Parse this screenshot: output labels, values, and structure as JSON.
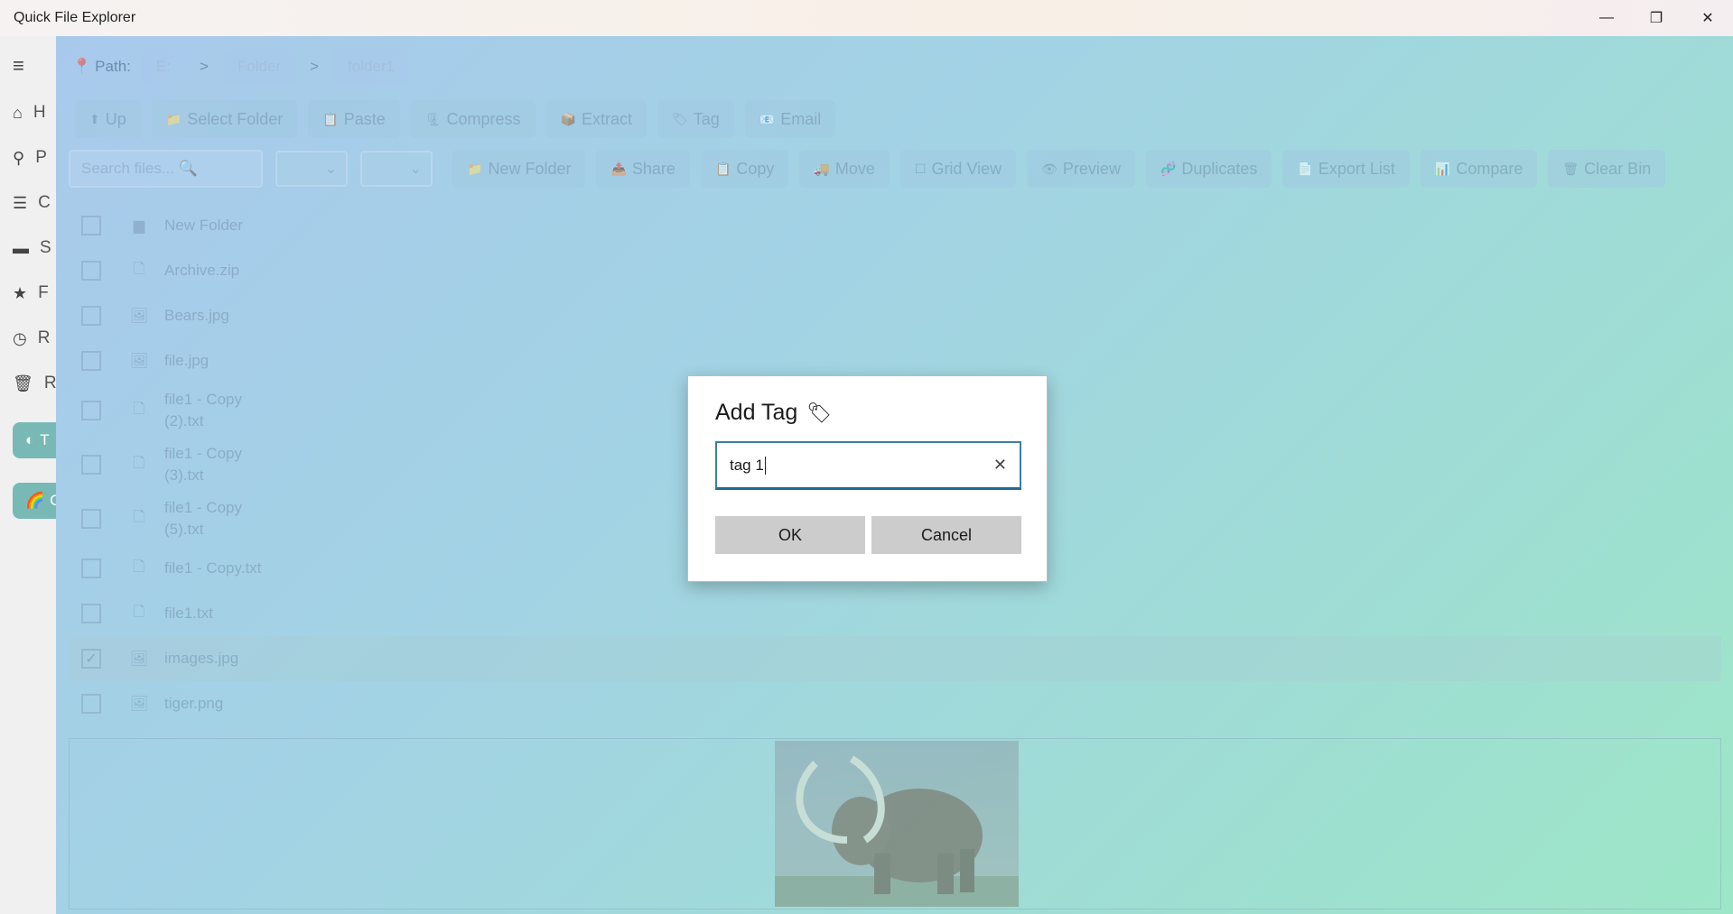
{
  "window": {
    "title": "Quick File Explorer",
    "minimize": "—",
    "maximize": "❐",
    "close": "✕"
  },
  "nav": {
    "menu": "≡",
    "items": [
      {
        "icon": "home-icon",
        "glyph": "⌂",
        "label": "H"
      },
      {
        "icon": "pin-icon",
        "glyph": "⚲",
        "label": "P"
      },
      {
        "icon": "list-icon",
        "glyph": "☰",
        "label": "C"
      },
      {
        "icon": "folder-icon",
        "glyph": "▬",
        "label": "S"
      },
      {
        "icon": "star-icon",
        "glyph": "★",
        "label": "F"
      },
      {
        "icon": "clock-icon",
        "glyph": "◷",
        "label": "R"
      },
      {
        "icon": "trash-icon",
        "glyph": "🗑",
        "label": "R"
      }
    ],
    "pills": [
      {
        "icon": "theme-icon",
        "glyph": "◐",
        "label": "T"
      },
      {
        "icon": "rainbow-icon",
        "glyph": "🌈",
        "label": "C"
      }
    ]
  },
  "path": {
    "label": "Path:",
    "segments": [
      "E:",
      "Folder",
      "folder1"
    ],
    "separator": ">"
  },
  "toolbar1": [
    {
      "name": "up-button",
      "icon": "⬆",
      "label": "Up"
    },
    {
      "name": "select-folder-button",
      "icon": "📁",
      "label": "Select Folder"
    },
    {
      "name": "paste-button",
      "icon": "📋",
      "label": "Paste"
    },
    {
      "name": "compress-button",
      "icon": "🗜",
      "label": "Compress"
    },
    {
      "name": "extract-button",
      "icon": "📦",
      "label": "Extract"
    },
    {
      "name": "tag-button",
      "icon": "🏷",
      "label": "Tag"
    },
    {
      "name": "email-button",
      "icon": "📧",
      "label": "Email"
    }
  ],
  "search": {
    "placeholder": "Search files... 🔍"
  },
  "toolbar2": [
    {
      "name": "new-folder-button",
      "icon": "📁",
      "label": "New Folder"
    },
    {
      "name": "share-button",
      "icon": "📤",
      "label": "Share"
    },
    {
      "name": "copy-button",
      "icon": "📋",
      "label": "Copy"
    },
    {
      "name": "move-button",
      "icon": "🚚",
      "label": "Move"
    },
    {
      "name": "grid-view-button",
      "icon": "☐",
      "label": "Grid View"
    },
    {
      "name": "preview-button",
      "icon": "👁",
      "label": "Preview"
    },
    {
      "name": "duplicates-button",
      "icon": "🧬",
      "label": "Duplicates"
    },
    {
      "name": "export-list-button",
      "icon": "📄",
      "label": "Export List"
    },
    {
      "name": "compare-button",
      "icon": "📊",
      "label": "Compare"
    },
    {
      "name": "clear-bin-button",
      "icon": "🗑",
      "label": "Clear Bin"
    }
  ],
  "files": [
    {
      "name": "New Folder",
      "type": "folder",
      "checked": false
    },
    {
      "name": "Archive.zip",
      "type": "file",
      "checked": false
    },
    {
      "name": "Bears.jpg",
      "type": "image",
      "checked": false
    },
    {
      "name": "file.jpg",
      "type": "image",
      "checked": false
    },
    {
      "name": "file1 - Copy (2).txt",
      "line1": "file1 - Copy",
      "line2": "(2).txt",
      "type": "file",
      "checked": false
    },
    {
      "name": "file1 - Copy (3).txt",
      "line1": "file1 - Copy",
      "line2": "(3).txt",
      "type": "file",
      "checked": false
    },
    {
      "name": "file1 - Copy (5).txt",
      "line1": "file1 - Copy",
      "line2": "(5).txt",
      "type": "file",
      "checked": false
    },
    {
      "name": "file1 - Copy.txt",
      "type": "file",
      "checked": false
    },
    {
      "name": "file1.txt",
      "type": "file",
      "checked": false
    },
    {
      "name": "images.jpg",
      "type": "image",
      "checked": true
    },
    {
      "name": "tiger.png",
      "type": "image",
      "checked": false
    }
  ],
  "dialog": {
    "title": "Add Tag",
    "title_icon": "🏷",
    "input_value": "tag 1",
    "clear_icon": "✕",
    "ok": "OK",
    "cancel": "Cancel"
  },
  "colors": {
    "accent": "#1f6a97",
    "content_bg_start": "#a9c9ec",
    "content_bg_end": "#9de6c7"
  }
}
